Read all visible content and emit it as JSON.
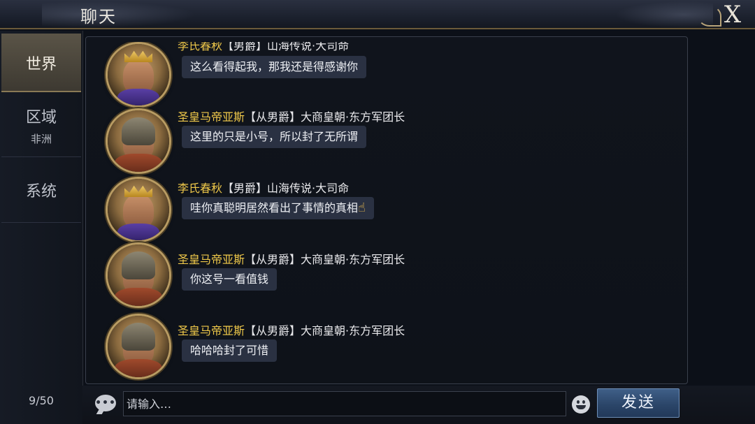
{
  "window": {
    "title": "聊天",
    "close_label": "X"
  },
  "sidebar": {
    "tabs": [
      {
        "label": "世界",
        "sub": ""
      },
      {
        "label": "区域",
        "sub": "非洲"
      },
      {
        "label": "系统",
        "sub": ""
      }
    ],
    "active_tab": "世界",
    "message_count": "9/50"
  },
  "messages": [
    {
      "avatar": "king-avatar",
      "name": "李氏春秋",
      "rest": "【男爵】山海传说·大司命",
      "text": "这么看得起我，那我还是得感谢你"
    },
    {
      "avatar": "warrior-avatar",
      "name": "圣皇马帝亚斯",
      "rest": "【从男爵】大商皇朝·东方军团长",
      "text": "这里的只是小号，所以封了无所谓"
    },
    {
      "avatar": "king-avatar",
      "name": "李氏春秋",
      "rest": "【男爵】山海传说·大司命",
      "text": "哇你真聪明居然看出了事情的真相",
      "emoji": "thumbs-up-icon"
    },
    {
      "avatar": "warrior-avatar",
      "name": "圣皇马帝亚斯",
      "rest": "【从男爵】大商皇朝·东方军团长",
      "text": "你这号一看值钱"
    },
    {
      "avatar": "warrior-avatar",
      "name": "圣皇马帝亚斯",
      "rest": "【从男爵】大商皇朝·东方军团长",
      "text": "哈哈哈封了可惜"
    }
  ],
  "input": {
    "placeholder": "请输入…",
    "value": "",
    "chat_icon_text": "•••"
  },
  "send_button": {
    "label": "发送"
  },
  "colors": {
    "name": "#f0c94a",
    "bubble": "#2a3142",
    "send": "#2a4467",
    "active_tab": "#5a5447"
  }
}
